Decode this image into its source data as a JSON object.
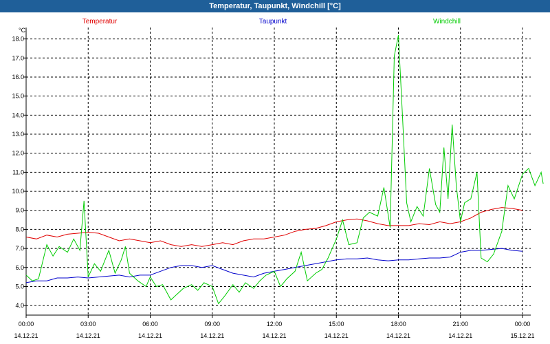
{
  "chart_data": {
    "type": "line",
    "title": "Temperatur, Taupunkt, Windchill [°C]",
    "unit": "°C",
    "ylim": [
      3.5,
      18.6
    ],
    "yticks": [
      "4.0",
      "5.0",
      "6.0",
      "7.0",
      "8.0",
      "9.0",
      "10.0",
      "11.0",
      "12.0",
      "13.0",
      "14.0",
      "15.0",
      "16.0",
      "17.0",
      "18.0"
    ],
    "xticks": [
      {
        "time": "00:00",
        "date": "14.12.21"
      },
      {
        "time": "03:00",
        "date": "14.12.21"
      },
      {
        "time": "06:00",
        "date": "14.12.21"
      },
      {
        "time": "09:00",
        "date": "14.12.21"
      },
      {
        "time": "12:00",
        "date": "14.12.21"
      },
      {
        "time": "15:00",
        "date": "14.12.21"
      },
      {
        "time": "18:00",
        "date": "14.12.21"
      },
      {
        "time": "21:00",
        "date": "14.12.21"
      },
      {
        "time": "00:00",
        "date": "15.12.21"
      }
    ],
    "grid": true,
    "series": [
      {
        "name": "Temperatur",
        "color": "#e00000",
        "points": [
          [
            0,
            7.6
          ],
          [
            0.5,
            7.5
          ],
          [
            1,
            7.7
          ],
          [
            1.5,
            7.6
          ],
          [
            2,
            7.75
          ],
          [
            2.5,
            7.8
          ],
          [
            3,
            7.85
          ],
          [
            3.5,
            7.8
          ],
          [
            4,
            7.6
          ],
          [
            4.5,
            7.4
          ],
          [
            5,
            7.5
          ],
          [
            5.5,
            7.4
          ],
          [
            6,
            7.3
          ],
          [
            6.5,
            7.4
          ],
          [
            7,
            7.2
          ],
          [
            7.5,
            7.1
          ],
          [
            8,
            7.2
          ],
          [
            8.5,
            7.1
          ],
          [
            9,
            7.2
          ],
          [
            9.5,
            7.3
          ],
          [
            10,
            7.2
          ],
          [
            10.5,
            7.4
          ],
          [
            11,
            7.5
          ],
          [
            11.5,
            7.5
          ],
          [
            12,
            7.6
          ],
          [
            12.5,
            7.7
          ],
          [
            13,
            7.9
          ],
          [
            13.5,
            8.0
          ],
          [
            14,
            8.05
          ],
          [
            14.5,
            8.2
          ],
          [
            15,
            8.4
          ],
          [
            15.5,
            8.5
          ],
          [
            16,
            8.55
          ],
          [
            16.5,
            8.45
          ],
          [
            17,
            8.3
          ],
          [
            17.5,
            8.2
          ],
          [
            18,
            8.2
          ],
          [
            18.5,
            8.2
          ],
          [
            19,
            8.3
          ],
          [
            19.5,
            8.25
          ],
          [
            20,
            8.4
          ],
          [
            20.5,
            8.3
          ],
          [
            21,
            8.4
          ],
          [
            21.5,
            8.6
          ],
          [
            22,
            8.9
          ],
          [
            22.5,
            9.05
          ],
          [
            23,
            9.15
          ],
          [
            23.5,
            9.1
          ],
          [
            24,
            9.0
          ]
        ]
      },
      {
        "name": "Taupunkt",
        "color": "#0000cc",
        "points": [
          [
            0,
            5.2
          ],
          [
            0.5,
            5.3
          ],
          [
            1,
            5.3
          ],
          [
            1.5,
            5.45
          ],
          [
            2,
            5.45
          ],
          [
            2.5,
            5.5
          ],
          [
            3,
            5.45
          ],
          [
            3.5,
            5.5
          ],
          [
            4,
            5.55
          ],
          [
            4.5,
            5.6
          ],
          [
            5,
            5.5
          ],
          [
            5.5,
            5.6
          ],
          [
            6,
            5.6
          ],
          [
            6.5,
            5.8
          ],
          [
            7,
            6.0
          ],
          [
            7.5,
            6.1
          ],
          [
            8,
            6.1
          ],
          [
            8.5,
            6.0
          ],
          [
            9,
            6.1
          ],
          [
            9.5,
            5.9
          ],
          [
            10,
            5.7
          ],
          [
            10.5,
            5.6
          ],
          [
            11,
            5.5
          ],
          [
            11.5,
            5.7
          ],
          [
            12,
            5.8
          ],
          [
            12.5,
            5.9
          ],
          [
            13,
            6.0
          ],
          [
            13.5,
            6.1
          ],
          [
            14,
            6.2
          ],
          [
            14.5,
            6.3
          ],
          [
            15,
            6.4
          ],
          [
            15.5,
            6.45
          ],
          [
            16,
            6.45
          ],
          [
            16.5,
            6.5
          ],
          [
            17,
            6.4
          ],
          [
            17.5,
            6.35
          ],
          [
            18,
            6.4
          ],
          [
            18.5,
            6.4
          ],
          [
            19,
            6.45
          ],
          [
            19.5,
            6.5
          ],
          [
            20,
            6.5
          ],
          [
            20.5,
            6.55
          ],
          [
            21,
            6.8
          ],
          [
            21.5,
            6.9
          ],
          [
            22,
            6.9
          ],
          [
            22.5,
            6.95
          ],
          [
            23,
            7.0
          ],
          [
            23.5,
            6.9
          ],
          [
            24,
            6.85
          ]
        ]
      },
      {
        "name": "Windchill",
        "color": "#00cc00",
        "points": [
          [
            0,
            5.6
          ],
          [
            0.3,
            5.3
          ],
          [
            0.6,
            5.4
          ],
          [
            1,
            7.2
          ],
          [
            1.3,
            6.6
          ],
          [
            1.6,
            7.1
          ],
          [
            2,
            6.8
          ],
          [
            2.3,
            7.5
          ],
          [
            2.6,
            6.9
          ],
          [
            2.8,
            9.5
          ],
          [
            3,
            5.5
          ],
          [
            3.3,
            6.2
          ],
          [
            3.6,
            5.8
          ],
          [
            4,
            6.9
          ],
          [
            4.3,
            5.7
          ],
          [
            4.6,
            6.4
          ],
          [
            4.8,
            7.1
          ],
          [
            5,
            5.7
          ],
          [
            5.4,
            5.3
          ],
          [
            5.8,
            5.0
          ],
          [
            6,
            5.5
          ],
          [
            6.3,
            5.0
          ],
          [
            6.6,
            5.1
          ],
          [
            7,
            4.3
          ],
          [
            7.3,
            4.6
          ],
          [
            7.6,
            4.9
          ],
          [
            8,
            5.1
          ],
          [
            8.3,
            4.8
          ],
          [
            8.6,
            5.2
          ],
          [
            9,
            5.0
          ],
          [
            9.3,
            4.1
          ],
          [
            9.6,
            4.5
          ],
          [
            10,
            5.1
          ],
          [
            10.3,
            4.7
          ],
          [
            10.6,
            5.2
          ],
          [
            11,
            4.9
          ],
          [
            11.3,
            5.3
          ],
          [
            11.6,
            5.6
          ],
          [
            12,
            5.8
          ],
          [
            12.3,
            5.0
          ],
          [
            12.6,
            5.4
          ],
          [
            13,
            5.8
          ],
          [
            13.3,
            6.8
          ],
          [
            13.6,
            5.3
          ],
          [
            14,
            5.7
          ],
          [
            14.3,
            5.9
          ],
          [
            14.6,
            6.5
          ],
          [
            15,
            7.5
          ],
          [
            15.3,
            8.5
          ],
          [
            15.6,
            7.2
          ],
          [
            16,
            7.3
          ],
          [
            16.3,
            8.6
          ],
          [
            16.6,
            8.9
          ],
          [
            17,
            8.7
          ],
          [
            17.3,
            10.2
          ],
          [
            17.6,
            8.1
          ],
          [
            17.8,
            17.1
          ],
          [
            18,
            18.2
          ],
          [
            18.2,
            13.9
          ],
          [
            18.4,
            9.4
          ],
          [
            18.6,
            8.4
          ],
          [
            18.9,
            9.2
          ],
          [
            19.2,
            8.7
          ],
          [
            19.5,
            11.2
          ],
          [
            19.8,
            9.3
          ],
          [
            20,
            8.9
          ],
          [
            20.2,
            12.3
          ],
          [
            20.4,
            9.6
          ],
          [
            20.6,
            13.5
          ],
          [
            20.8,
            10.3
          ],
          [
            21,
            8.4
          ],
          [
            21.2,
            9.4
          ],
          [
            21.5,
            9.6
          ],
          [
            21.8,
            11.0
          ],
          [
            22,
            6.5
          ],
          [
            22.3,
            6.3
          ],
          [
            22.6,
            6.7
          ],
          [
            23,
            7.9
          ],
          [
            23.3,
            10.3
          ],
          [
            23.6,
            9.6
          ],
          [
            24,
            10.9
          ],
          [
            24.3,
            11.2
          ],
          [
            24.6,
            10.3
          ],
          [
            24.9,
            11.0
          ],
          [
            25,
            10.4
          ]
        ]
      }
    ]
  }
}
